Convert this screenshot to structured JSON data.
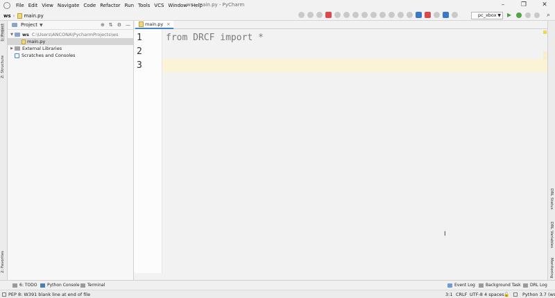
{
  "window": {
    "title": "ws - main.py - PyCharm",
    "controls": [
      "–",
      "❐",
      "✕"
    ]
  },
  "menu": [
    "File",
    "Edit",
    "View",
    "Navigate",
    "Code",
    "Refactor",
    "Run",
    "Tools",
    "VCS",
    "Window",
    "Help"
  ],
  "navbar": {
    "project": "ws",
    "file": "main.py",
    "run_config": "pc_xbox"
  },
  "left_stripe": {
    "project_tab": "1: Project",
    "structure_tab": "Z: Structure",
    "favorites_tab": "2: Favorites"
  },
  "project_panel": {
    "title": "Project",
    "tree": [
      {
        "label": "ws",
        "path": "C:\\Users\\ANCONA\\PycharmProjects\\ws",
        "expanded": true
      },
      {
        "label": "main.py",
        "selected": true
      },
      {
        "label": "External Libraries"
      },
      {
        "label": "Scratches and Consoles"
      }
    ]
  },
  "editor": {
    "tab": "main.py",
    "lines": [
      "from DRCF import *",
      "",
      ""
    ],
    "line_numbers": [
      "1",
      "2",
      "3"
    ],
    "current_line": 3
  },
  "right_stripe": {
    "tabs": [
      "DRL Status",
      "DRL Variables",
      "Monitoring"
    ]
  },
  "tool_windows": {
    "todo": "6: TODO",
    "python_console": "Python Console",
    "terminal": "Terminal",
    "event_log": "Event Log",
    "background_task": "Background Task",
    "drl_log": "DRL Log"
  },
  "status": {
    "message": "PEP 8: W391 blank line at end of file",
    "position": "3:1",
    "line_sep": "CRLF",
    "encoding": "UTF-8",
    "indent": "4 spaces",
    "interpreter": "Python 3.7 (ws)"
  }
}
